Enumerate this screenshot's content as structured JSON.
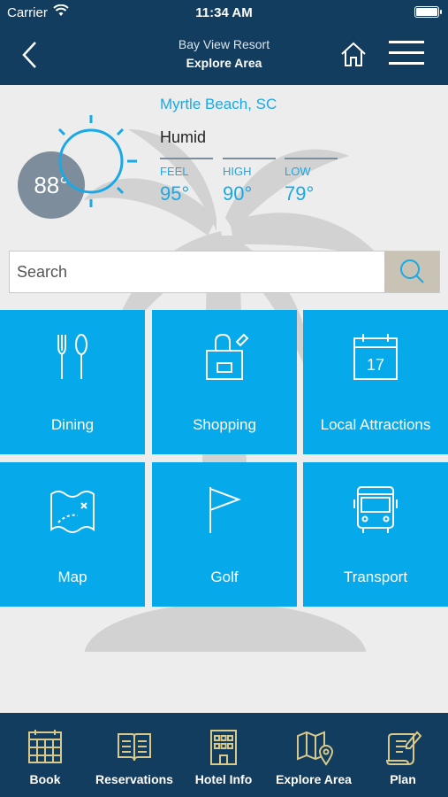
{
  "status": {
    "carrier": "Carrier",
    "time": "11:34 AM"
  },
  "nav": {
    "title": "Bay View Resort",
    "subtitle": "Explore Area"
  },
  "weather": {
    "temperature": "88°",
    "location": "Myrtle Beach, SC",
    "condition": "Humid",
    "feel_label": "FEEL",
    "feel_value": "95°",
    "high_label": "HIGH",
    "high_value": "90°",
    "low_label": "LOW",
    "low_value": "79°"
  },
  "search": {
    "placeholder": "Search"
  },
  "tiles": [
    {
      "label": "Dining",
      "icon": "dining-icon"
    },
    {
      "label": "Shopping",
      "icon": "shopping-icon"
    },
    {
      "label": "Local Attractions",
      "icon": "calendar-icon"
    },
    {
      "label": "Map",
      "icon": "map-icon"
    },
    {
      "label": "Golf",
      "icon": "golf-flag-icon"
    },
    {
      "label": "Transport",
      "icon": "bus-icon"
    }
  ],
  "calendar_day": "17",
  "tabs": [
    {
      "label": "Book",
      "icon": "calendar-grid-icon"
    },
    {
      "label": "Reservations",
      "icon": "book-icon"
    },
    {
      "label": "Hotel Info",
      "icon": "hotel-icon"
    },
    {
      "label": "Explore Area",
      "icon": "map-pin-icon"
    },
    {
      "label": "Plan",
      "icon": "scroll-pen-icon"
    }
  ],
  "colors": {
    "header": "#123d5f",
    "tile": "#06aaea",
    "accent": "#19a9e6",
    "tab_icon": "#d8c98a"
  }
}
